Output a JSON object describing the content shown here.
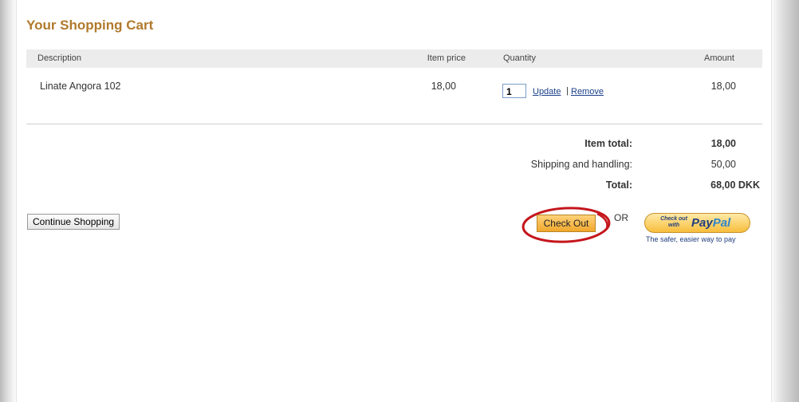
{
  "title": "Your Shopping Cart",
  "table": {
    "headers": {
      "description": "Description",
      "item_price": "Item price",
      "quantity": "Quantity",
      "amount": "Amount"
    },
    "rows": [
      {
        "description": "Linate Angora 102",
        "item_price": "18,00",
        "quantity": "1",
        "update": "Update",
        "separator": "|",
        "remove": "Remove",
        "amount": "18,00"
      }
    ]
  },
  "summary": {
    "item_total_label": "Item total:",
    "item_total_value": "18,00",
    "shipping_label": "Shipping and handling:",
    "shipping_value": "50,00",
    "total_label": "Total:",
    "total_value": "68,00 DKK"
  },
  "actions": {
    "continue_shopping": "Continue Shopping",
    "check_out": "Check Out",
    "or": "OR",
    "paypal_small": "Check out with",
    "paypal_brand_dark": "Pay",
    "paypal_brand_light": "Pal",
    "paypal_tagline": "The safer, easier way to pay"
  },
  "colors": {
    "title": "#b07a2d",
    "highlight_circle": "#c4161c",
    "link": "#1a3f8a"
  }
}
